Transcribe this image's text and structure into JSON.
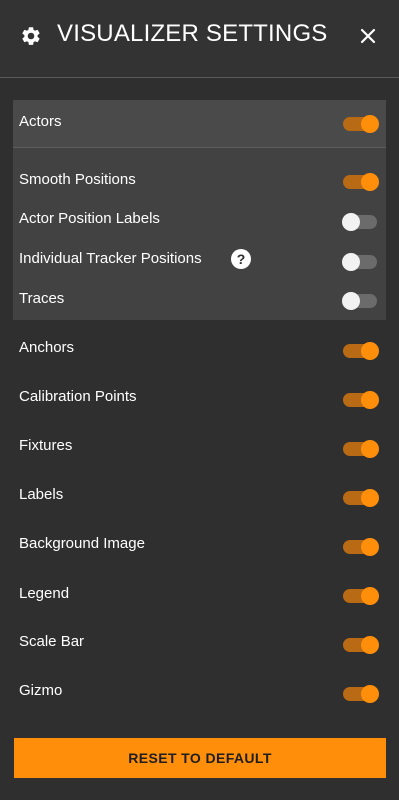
{
  "header": {
    "title": "VISUALIZER SETTINGS",
    "icon": "gear-icon",
    "close_icon": "close-icon"
  },
  "colors": {
    "accent": "#ff8f0a",
    "toggle_on_track": "#b86a14",
    "toggle_off_track": "#6b6b6b",
    "background": "#2f2f2f"
  },
  "actors_group": {
    "label": "Actors",
    "enabled": true,
    "children": [
      {
        "label": "Smooth Positions",
        "enabled": true
      },
      {
        "label": "Actor Position Labels",
        "enabled": false
      },
      {
        "label": "Individual Tracker Positions",
        "enabled": false,
        "help_icon": "question-mark-icon"
      },
      {
        "label": "Traces",
        "enabled": false
      }
    ]
  },
  "settings": [
    {
      "label": "Anchors",
      "enabled": true
    },
    {
      "label": "Calibration Points",
      "enabled": true
    },
    {
      "label": "Fixtures",
      "enabled": true
    },
    {
      "label": "Labels",
      "enabled": true
    },
    {
      "label": "Background Image",
      "enabled": true
    },
    {
      "label": "Legend",
      "enabled": true
    },
    {
      "label": "Scale Bar",
      "enabled": true
    },
    {
      "label": "Gizmo",
      "enabled": true
    }
  ],
  "reset_button": {
    "label": "RESET TO DEFAULT"
  }
}
